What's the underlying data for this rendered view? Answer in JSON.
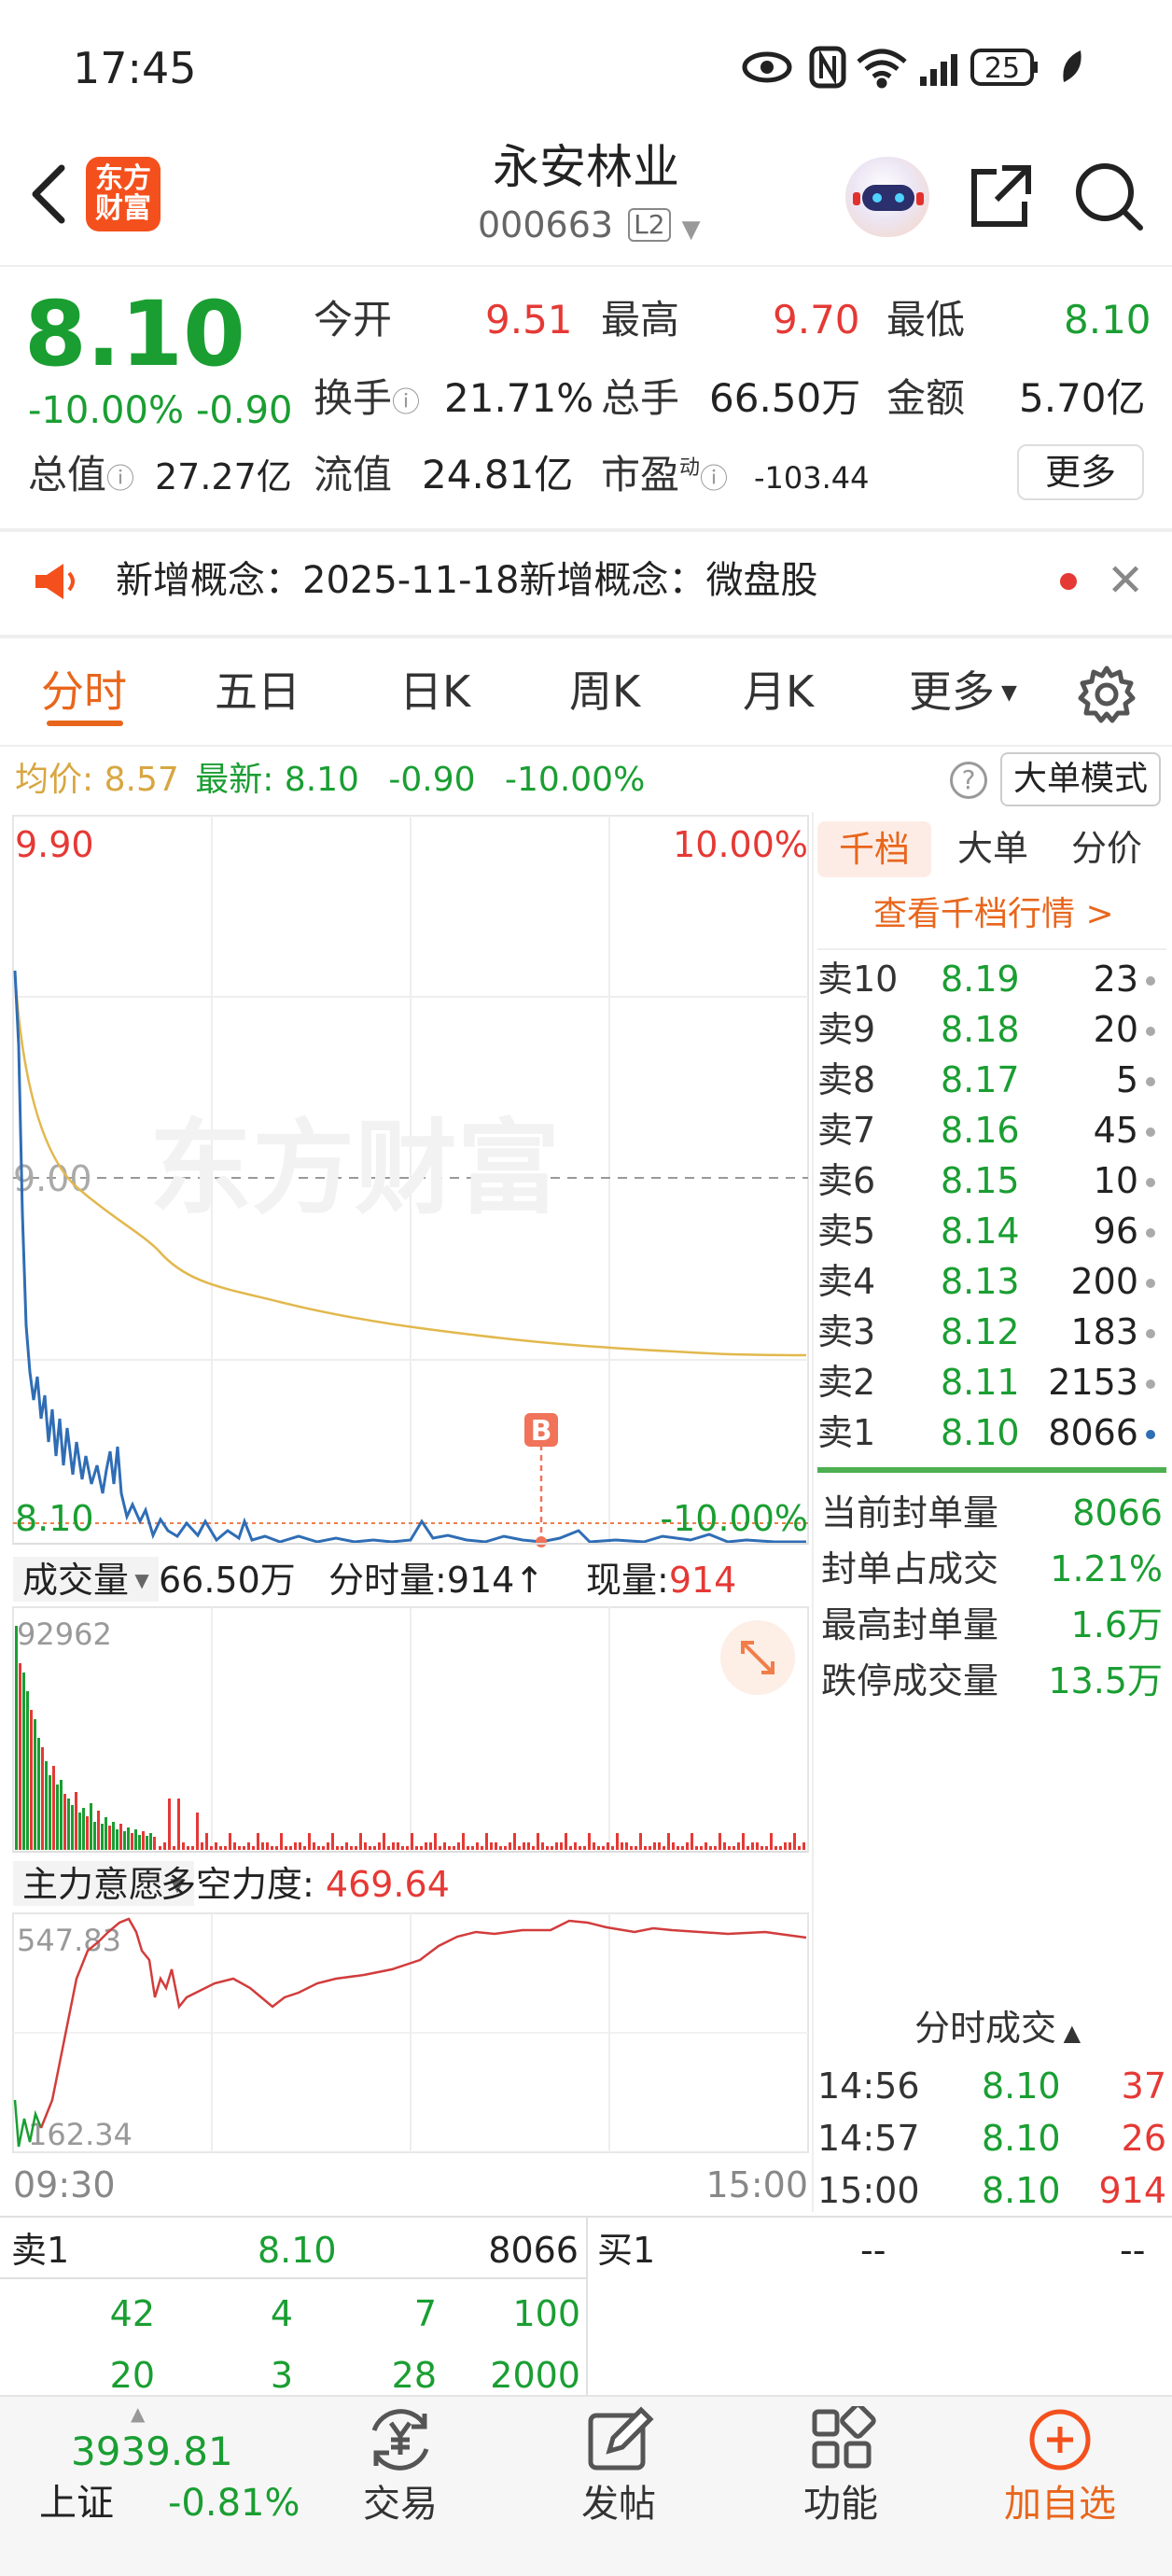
{
  "status": {
    "time": "17:45",
    "battery": "25"
  },
  "header": {
    "title": "永安林业",
    "code": "000663",
    "level": "L2",
    "logo_line1": "东方",
    "logo_line2": "财富"
  },
  "quote": {
    "price": "8.10",
    "change_pct": "-10.00%",
    "change": "-0.90",
    "open_label": "今开",
    "open": "9.51",
    "high_label": "最高",
    "high": "9.70",
    "low_label": "最低",
    "low": "8.10",
    "turnover_label": "换手",
    "turnover": "21.71%",
    "volume_label": "总手",
    "volume": "66.50万",
    "amount_label": "金额",
    "amount": "5.70亿",
    "mktcap_label": "总值",
    "mktcap": "27.27亿",
    "float_label": "流值",
    "float": "24.81亿",
    "pe_label": "市盈",
    "pe_sup": "动",
    "pe": "-103.44",
    "more": "更多"
  },
  "notice": {
    "text": "新增概念：2025-11-18新增概念：微盘股"
  },
  "tabs": [
    "分时",
    "五日",
    "日K",
    "周K",
    "月K",
    "更多"
  ],
  "info": {
    "avg_label": "均价:",
    "avg": "8.57",
    "latest_label": "最新:",
    "latest": "8.10",
    "change": "-0.90",
    "pct": "-10.00%",
    "mode": "大单模式"
  },
  "chart": {
    "ymax": "9.90",
    "ymax_pct": "10.00%",
    "ymid": "9.00",
    "ymin": "8.10",
    "ymin_pct": "-10.00%",
    "watermark": "东方财富",
    "marker": "B",
    "t_start": "09:30",
    "t_end": "15:00"
  },
  "volume": {
    "selector": "成交量",
    "total": "66.50万",
    "period_label": "分时量:",
    "period": "914↑",
    "now_label": "现量:",
    "now": "914",
    "max": "92962"
  },
  "force": {
    "selector": "主力意愿",
    "label": "多空力度:",
    "value": "469.64",
    "max": "547.83",
    "min": "162.34"
  },
  "side_tabs": [
    "千档",
    "大单",
    "分价"
  ],
  "depth_link": "查看千档行情 >",
  "asks": [
    {
      "label": "卖10",
      "price": "8.19",
      "vol": "23"
    },
    {
      "label": "卖9",
      "price": "8.18",
      "vol": "20"
    },
    {
      "label": "卖8",
      "price": "8.17",
      "vol": "5"
    },
    {
      "label": "卖7",
      "price": "8.16",
      "vol": "45"
    },
    {
      "label": "卖6",
      "price": "8.15",
      "vol": "10"
    },
    {
      "label": "卖5",
      "price": "8.14",
      "vol": "96"
    },
    {
      "label": "卖4",
      "price": "8.13",
      "vol": "200"
    },
    {
      "label": "卖3",
      "price": "8.12",
      "vol": "183"
    },
    {
      "label": "卖2",
      "price": "8.11",
      "vol": "2153"
    },
    {
      "label": "卖1",
      "price": "8.10",
      "vol": "8066"
    }
  ],
  "seal": [
    {
      "label": "当前封单量",
      "value": "8066"
    },
    {
      "label": "封单占成交",
      "value": "1.21%"
    },
    {
      "label": "最高封单量",
      "value": "1.6万"
    },
    {
      "label": "跌停成交量",
      "value": "13.5万"
    }
  ],
  "ticks_title": "分时成交",
  "ticks": [
    {
      "time": "14:56",
      "price": "8.10",
      "vol": "37"
    },
    {
      "time": "14:57",
      "price": "8.10",
      "vol": "26"
    },
    {
      "time": "15:00",
      "price": "8.10",
      "vol": "914"
    }
  ],
  "orders": {
    "ask_label": "卖1",
    "ask_price": "8.10",
    "ask_vol": "8066",
    "bid_label": "买1",
    "bid_price": "--",
    "bid_vol": "--",
    "rows": [
      [
        "42",
        "4",
        "7",
        "100"
      ],
      [
        "20",
        "3",
        "28",
        "2000"
      ]
    ]
  },
  "bottom": {
    "index_value": "3939.81",
    "index_name": "上证",
    "index_change": "-0.81%",
    "trade": "交易",
    "post": "发帖",
    "func": "功能",
    "watch": "加自选"
  }
}
